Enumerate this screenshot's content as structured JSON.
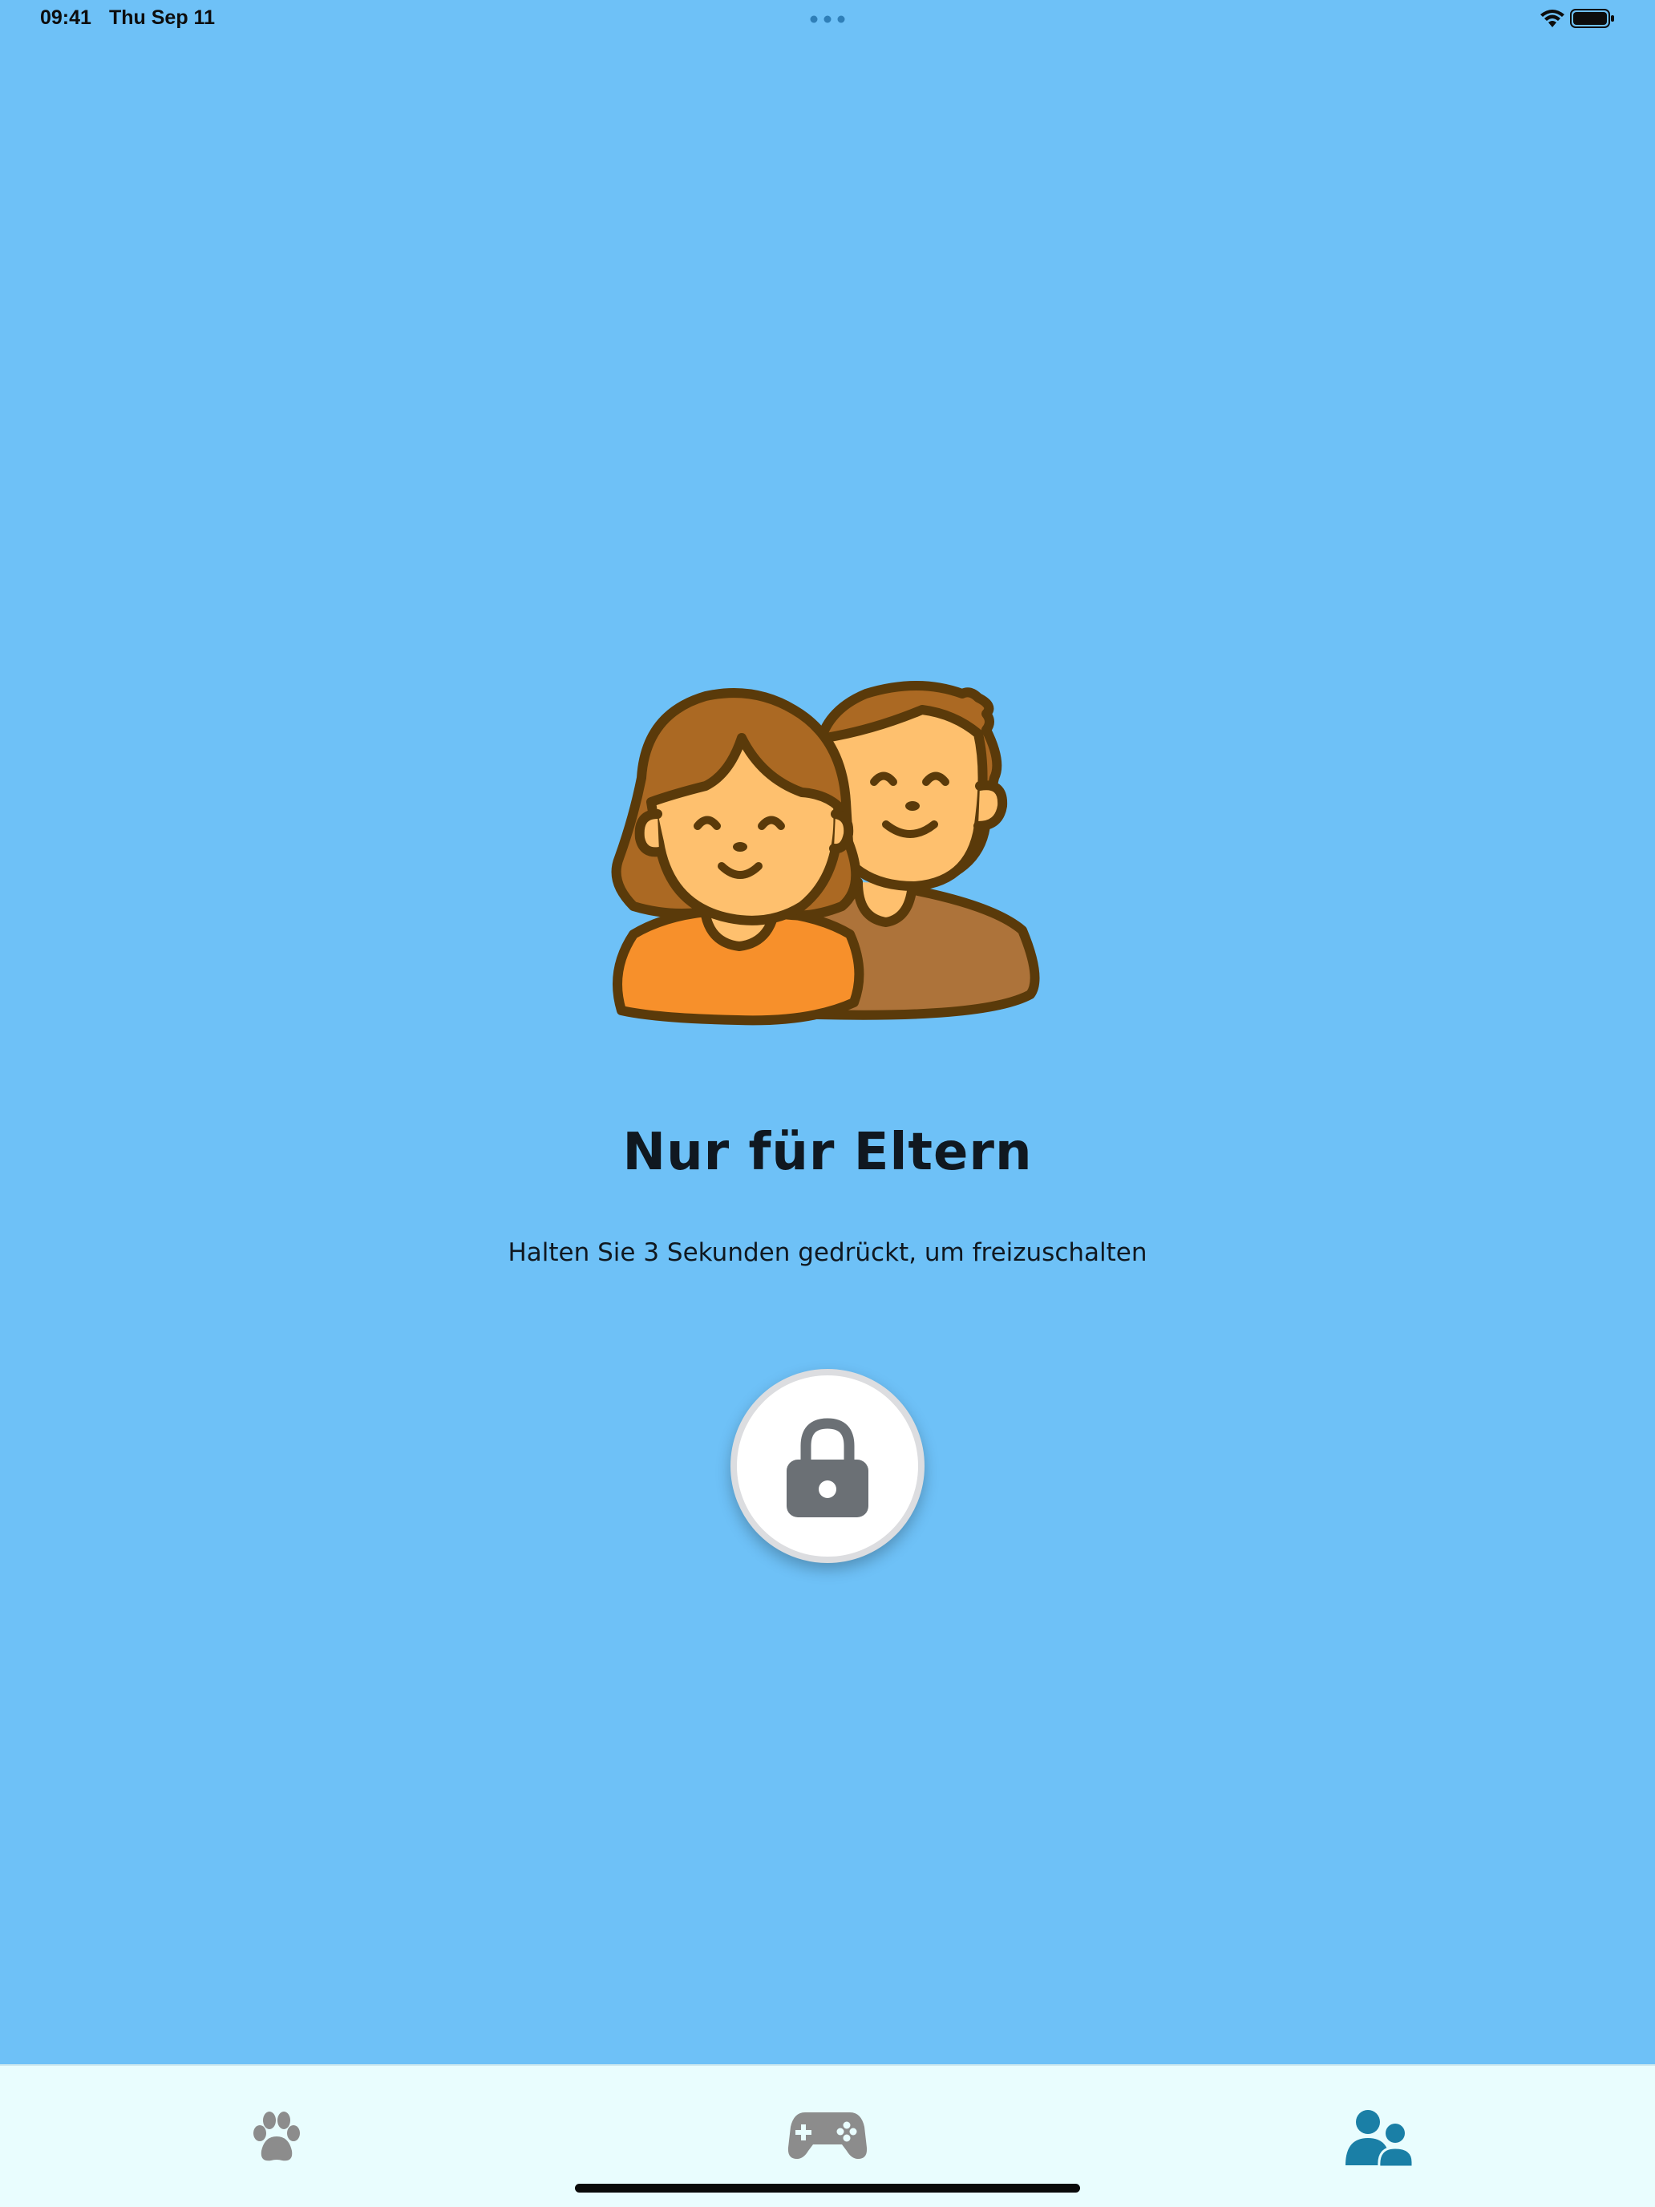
{
  "status_bar": {
    "time": "09:41",
    "date": "Thu Sep 11"
  },
  "main": {
    "title": "Nur für Eltern",
    "subtitle": "Halten Sie 3 Sekunden gedrückt, um freizuschalten",
    "illustration_icon": "parents-icon",
    "unlock_button_icon": "lock-icon"
  },
  "tab_bar": {
    "tabs": [
      {
        "icon": "paw-icon",
        "selected": false
      },
      {
        "icon": "gamepad-icon",
        "selected": false
      },
      {
        "icon": "parents-user-icon",
        "selected": true
      }
    ]
  },
  "colors": {
    "background": "#6EC1F7",
    "tab_bar_background": "#E9FDFE",
    "tab_active": "#1A7FA6",
    "tab_inactive": "#8C8C8C",
    "lock_gray": "#6B7075"
  }
}
